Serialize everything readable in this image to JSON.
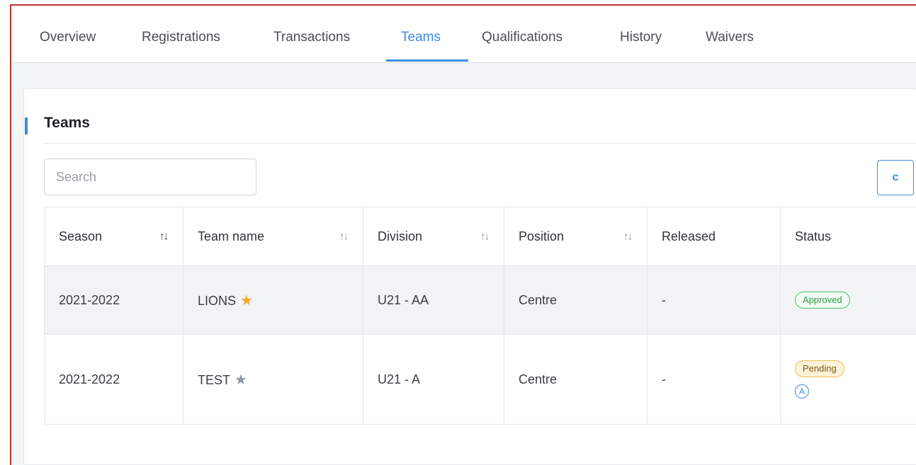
{
  "tabs": [
    {
      "label": "Overview"
    },
    {
      "label": "Registrations"
    },
    {
      "label": "Transactions"
    },
    {
      "label": "Teams"
    },
    {
      "label": "Qualifications"
    },
    {
      "label": "History"
    },
    {
      "label": "Waivers"
    }
  ],
  "active_tab": "Teams",
  "section": {
    "title": "Teams"
  },
  "search": {
    "placeholder": "Search",
    "value": ""
  },
  "refresh": {
    "glyph": "c"
  },
  "table": {
    "headers": [
      "Season",
      "Team name",
      "Division",
      "Position",
      "Released",
      "Status"
    ],
    "sortable": [
      true,
      true,
      true,
      true,
      false,
      false
    ],
    "sort_active_column": "Season",
    "rows": [
      {
        "season": "2021-2022",
        "team": "LIONS",
        "favorite": true,
        "division": "U21 - AA",
        "position": "Centre",
        "released": "-",
        "status": "Approved",
        "extra": ""
      },
      {
        "season": "2021-2022",
        "team": "TEST",
        "favorite": false,
        "division": "U21 - A",
        "position": "Centre",
        "released": "-",
        "status": "Pending",
        "extra": "A"
      }
    ]
  },
  "colors": {
    "accent": "#3d8cdf",
    "approved": "#27a243",
    "pending_bg": "#fdf2d7",
    "star_favorite": "#f5a623",
    "star_default": "#8c98a6",
    "frame_border": "#c0322b"
  },
  "icons": {
    "sort": "sort-arrows-icon",
    "star": "star-icon",
    "refresh": "refresh-icon"
  }
}
